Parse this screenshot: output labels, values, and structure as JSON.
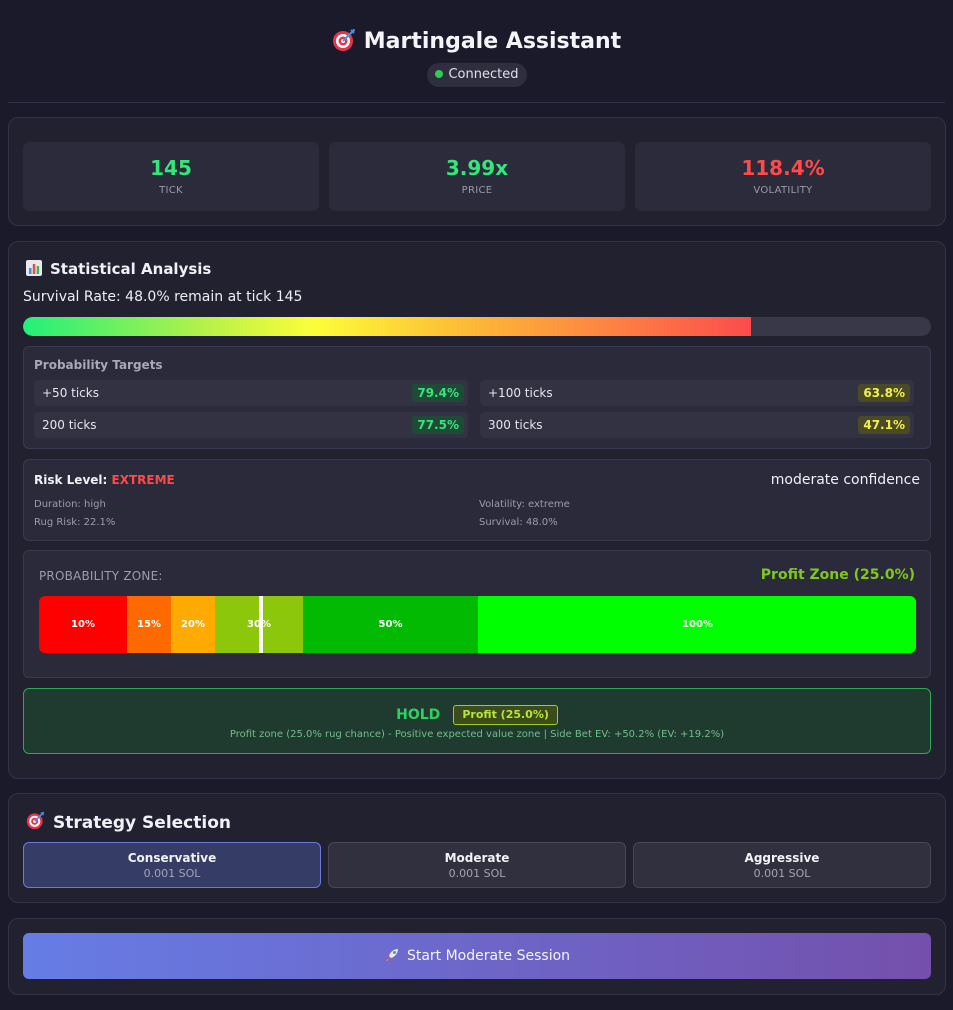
{
  "header": {
    "title": "Martingale Assistant",
    "title_icon": "dart-target-icon",
    "status": "Connected",
    "status_color": "#2ecc55"
  },
  "stats": [
    {
      "value": "145",
      "label": "TICK",
      "color": "#35e67b"
    },
    {
      "value": "3.99x",
      "label": "PRICE",
      "color": "#35e67b"
    },
    {
      "value": "118.4%",
      "label": "VOLATILITY",
      "color": "#ff4a4a"
    }
  ],
  "analysis": {
    "title": "Statistical Analysis",
    "title_icon": "bar-chart-icon",
    "survival_text": "Survival Rate: 48.0% remain at tick 145",
    "survival_bar_fill": 0.802,
    "targets_title": "Probability Targets",
    "targets": [
      {
        "label": "+50 ticks",
        "value": "79.4%",
        "tone": "green"
      },
      {
        "label": "+100 ticks",
        "value": "63.8%",
        "tone": "yellow"
      },
      {
        "label": "200 ticks",
        "value": "77.5%",
        "tone": "green"
      },
      {
        "label": "300 ticks",
        "value": "47.1%",
        "tone": "yellow"
      }
    ],
    "risk": {
      "label": "Risk Level:",
      "level": "EXTREME",
      "confidence": "moderate confidence",
      "details": [
        "Duration: high",
        "Volatility: extreme",
        "Rug Risk: 22.1%",
        "Survival: 48.0%"
      ]
    },
    "zone": {
      "label": "PROBABILITY ZONE:",
      "current": "Profit Zone (25.0%)",
      "marker_fraction": 0.253,
      "segments": [
        {
          "label": "10%",
          "color": "#ff0000",
          "width_fraction": 0.1
        },
        {
          "label": "15%",
          "color": "#ff6a00",
          "width_fraction": 0.05
        },
        {
          "label": "20%",
          "color": "#ffaa00",
          "width_fraction": 0.05
        },
        {
          "label": "30%",
          "color": "#8dc70c",
          "width_fraction": 0.1
        },
        {
          "label": "50%",
          "color": "#02ba02",
          "width_fraction": 0.2
        },
        {
          "label": "100%",
          "color": "#00ff00",
          "width_fraction": 0.5
        }
      ]
    },
    "recommendation": {
      "action": "HOLD",
      "badge": "Profit (25.0%)",
      "description": "Profit zone (25.0% rug chance) - Positive expected value zone | Side Bet EV: +50.2% (EV: +19.2%)"
    }
  },
  "strategy": {
    "title": "Strategy Selection",
    "title_icon": "dart-target-icon",
    "options": [
      {
        "name": "Conservative",
        "amount": "0.001 SOL",
        "active": true
      },
      {
        "name": "Moderate",
        "amount": "0.001 SOL",
        "active": false
      },
      {
        "name": "Aggressive",
        "amount": "0.001 SOL",
        "active": false
      }
    ]
  },
  "start_button": {
    "label": "Start Moderate Session",
    "icon": "rocket-icon"
  }
}
